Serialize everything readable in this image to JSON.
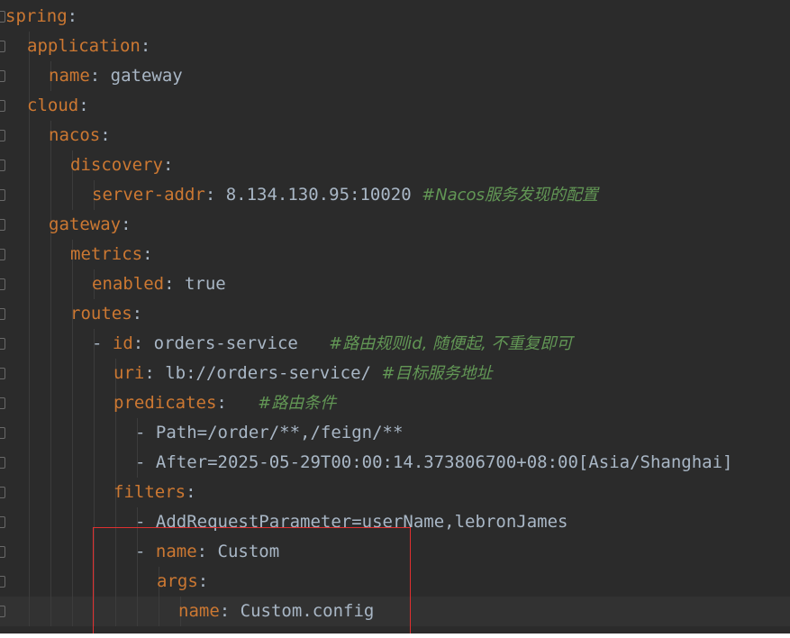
{
  "editor": {
    "language": "YAML",
    "current_line_index": 20,
    "lines": [
      {
        "indent": 0,
        "dash": "",
        "key": "spring",
        "sep": ":",
        "value": "",
        "comment": ""
      },
      {
        "indent": 1,
        "dash": "",
        "key": "application",
        "sep": ":",
        "value": "",
        "comment": ""
      },
      {
        "indent": 2,
        "dash": "",
        "key": "name",
        "sep": ":",
        "value": " gateway",
        "comment": ""
      },
      {
        "indent": 1,
        "dash": "",
        "key": "cloud",
        "sep": ":",
        "value": "",
        "comment": ""
      },
      {
        "indent": 2,
        "dash": "",
        "key": "nacos",
        "sep": ":",
        "value": "",
        "comment": ""
      },
      {
        "indent": 3,
        "dash": "",
        "key": "discovery",
        "sep": ":",
        "value": "",
        "comment": ""
      },
      {
        "indent": 4,
        "dash": "",
        "key": "server-addr",
        "sep": ":",
        "value": " 8.134.130.95:10020 ",
        "comment": "#Nacos服务发现的配置"
      },
      {
        "indent": 2,
        "dash": "",
        "key": "gateway",
        "sep": ":",
        "value": "",
        "comment": ""
      },
      {
        "indent": 3,
        "dash": "",
        "key": "metrics",
        "sep": ":",
        "value": "",
        "comment": ""
      },
      {
        "indent": 4,
        "dash": "",
        "key": "enabled",
        "sep": ":",
        "value": " true",
        "comment": ""
      },
      {
        "indent": 3,
        "dash": "",
        "key": "routes",
        "sep": ":",
        "value": "",
        "comment": ""
      },
      {
        "indent": 4,
        "dash": "- ",
        "key": "id",
        "sep": ":",
        "value": " orders-service   ",
        "comment": "#路由规则id, 随便起, 不重复即可"
      },
      {
        "indent": 5,
        "dash": "",
        "key": "uri",
        "sep": ":",
        "value": " lb://orders-service/ ",
        "comment": "#目标服务地址"
      },
      {
        "indent": 5,
        "dash": "",
        "key": "predicates",
        "sep": ":",
        "value": "   ",
        "comment": "#路由条件"
      },
      {
        "indent": 6,
        "dash": "- ",
        "key": "",
        "sep": "",
        "value": "Path=/order/**,/feign/**",
        "comment": ""
      },
      {
        "indent": 6,
        "dash": "- ",
        "key": "",
        "sep": "",
        "value": "After=2025-05-29T00:00:14.373806700+08:00[Asia/Shanghai]",
        "comment": ""
      },
      {
        "indent": 5,
        "dash": "",
        "key": "filters",
        "sep": ":",
        "value": "",
        "comment": ""
      },
      {
        "indent": 6,
        "dash": "- ",
        "key": "",
        "sep": "",
        "value": "AddRequestParameter=userName,lebronJames",
        "comment": ""
      },
      {
        "indent": 6,
        "dash": "- ",
        "key": "name",
        "sep": ":",
        "value": " Custom",
        "comment": ""
      },
      {
        "indent": 7,
        "dash": "",
        "key": "args",
        "sep": ":",
        "value": "",
        "comment": ""
      },
      {
        "indent": 8,
        "dash": "",
        "key": "name",
        "sep": ":",
        "value": " Custom.config",
        "comment": ""
      }
    ]
  },
  "colors": {
    "background": "#2b2b2b",
    "key": "#cc7832",
    "text": "#a9b7c6",
    "comment": "#629755",
    "highlight_box": "#e03030"
  }
}
